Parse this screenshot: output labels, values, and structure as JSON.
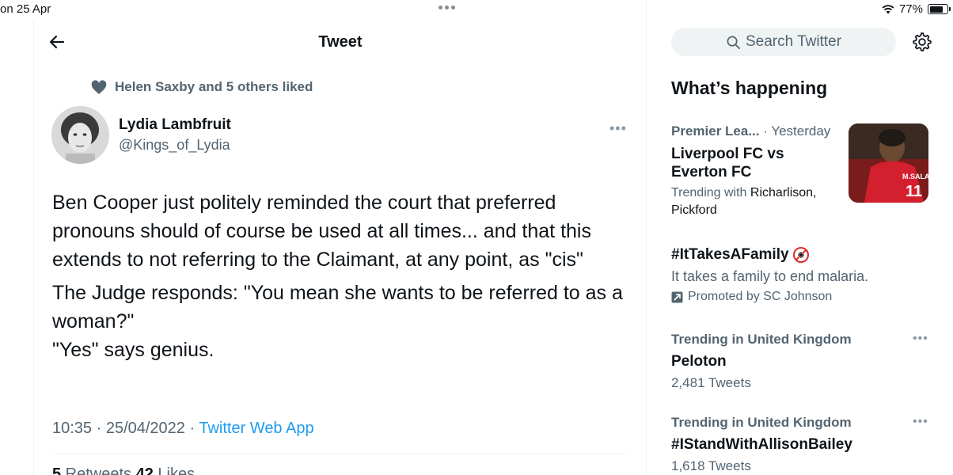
{
  "status": {
    "time": "on 25 Apr",
    "battery": "77%",
    "battery_level": 0.77
  },
  "header": {
    "title": "Tweet"
  },
  "tweet": {
    "social_context": "Helen Saxby and 5 others liked",
    "author_name": "Lydia Lambfruit",
    "author_handle": "@Kings_of_Lydia",
    "paragraph_1": "Ben Cooper just politely reminded the court that preferred pronouns should of course be used at all times... and that this extends to not referring to the Claimant, at any point, as \"cis\"",
    "paragraph_2_line_1": "The Judge responds: \"You mean she wants to be referred to as a woman?\"",
    "paragraph_2_line_2": "\"Yes\" says genius.",
    "time": "10:35 · 25/04/2022 · ",
    "source": "Twitter Web App",
    "retweets": "5",
    "retweets_label": " Retweets  ",
    "likes": "42",
    "likes_label": " Likes"
  },
  "search": {
    "placeholder": "Search Twitter"
  },
  "whats_happening": {
    "title": "What’s happening",
    "trend_1": {
      "category": "Premier Lea...",
      "when": " · Yesterday",
      "title": "Liverpool FC vs Everton FC",
      "trending_with": "Trending with ",
      "names": "Richarlison, Pickford",
      "image_text_name": "M.SALAH",
      "image_text_number": "11"
    },
    "promoted": {
      "title": "#ItTakesAFamily",
      "description": "It takes a family to end malaria.",
      "by": "Promoted by SC Johnson"
    },
    "trend_2": {
      "category": "Trending in United Kingdom",
      "title": "Peloton",
      "count": "2,481 Tweets"
    },
    "trend_3": {
      "category": "Trending in United Kingdom",
      "title": "#IStandWithAllisonBailey",
      "count": "1,618 Tweets"
    }
  },
  "colors": {
    "accent": "#1d9bf0",
    "secondary_text": "#536471",
    "primary_text": "#0f1419"
  }
}
